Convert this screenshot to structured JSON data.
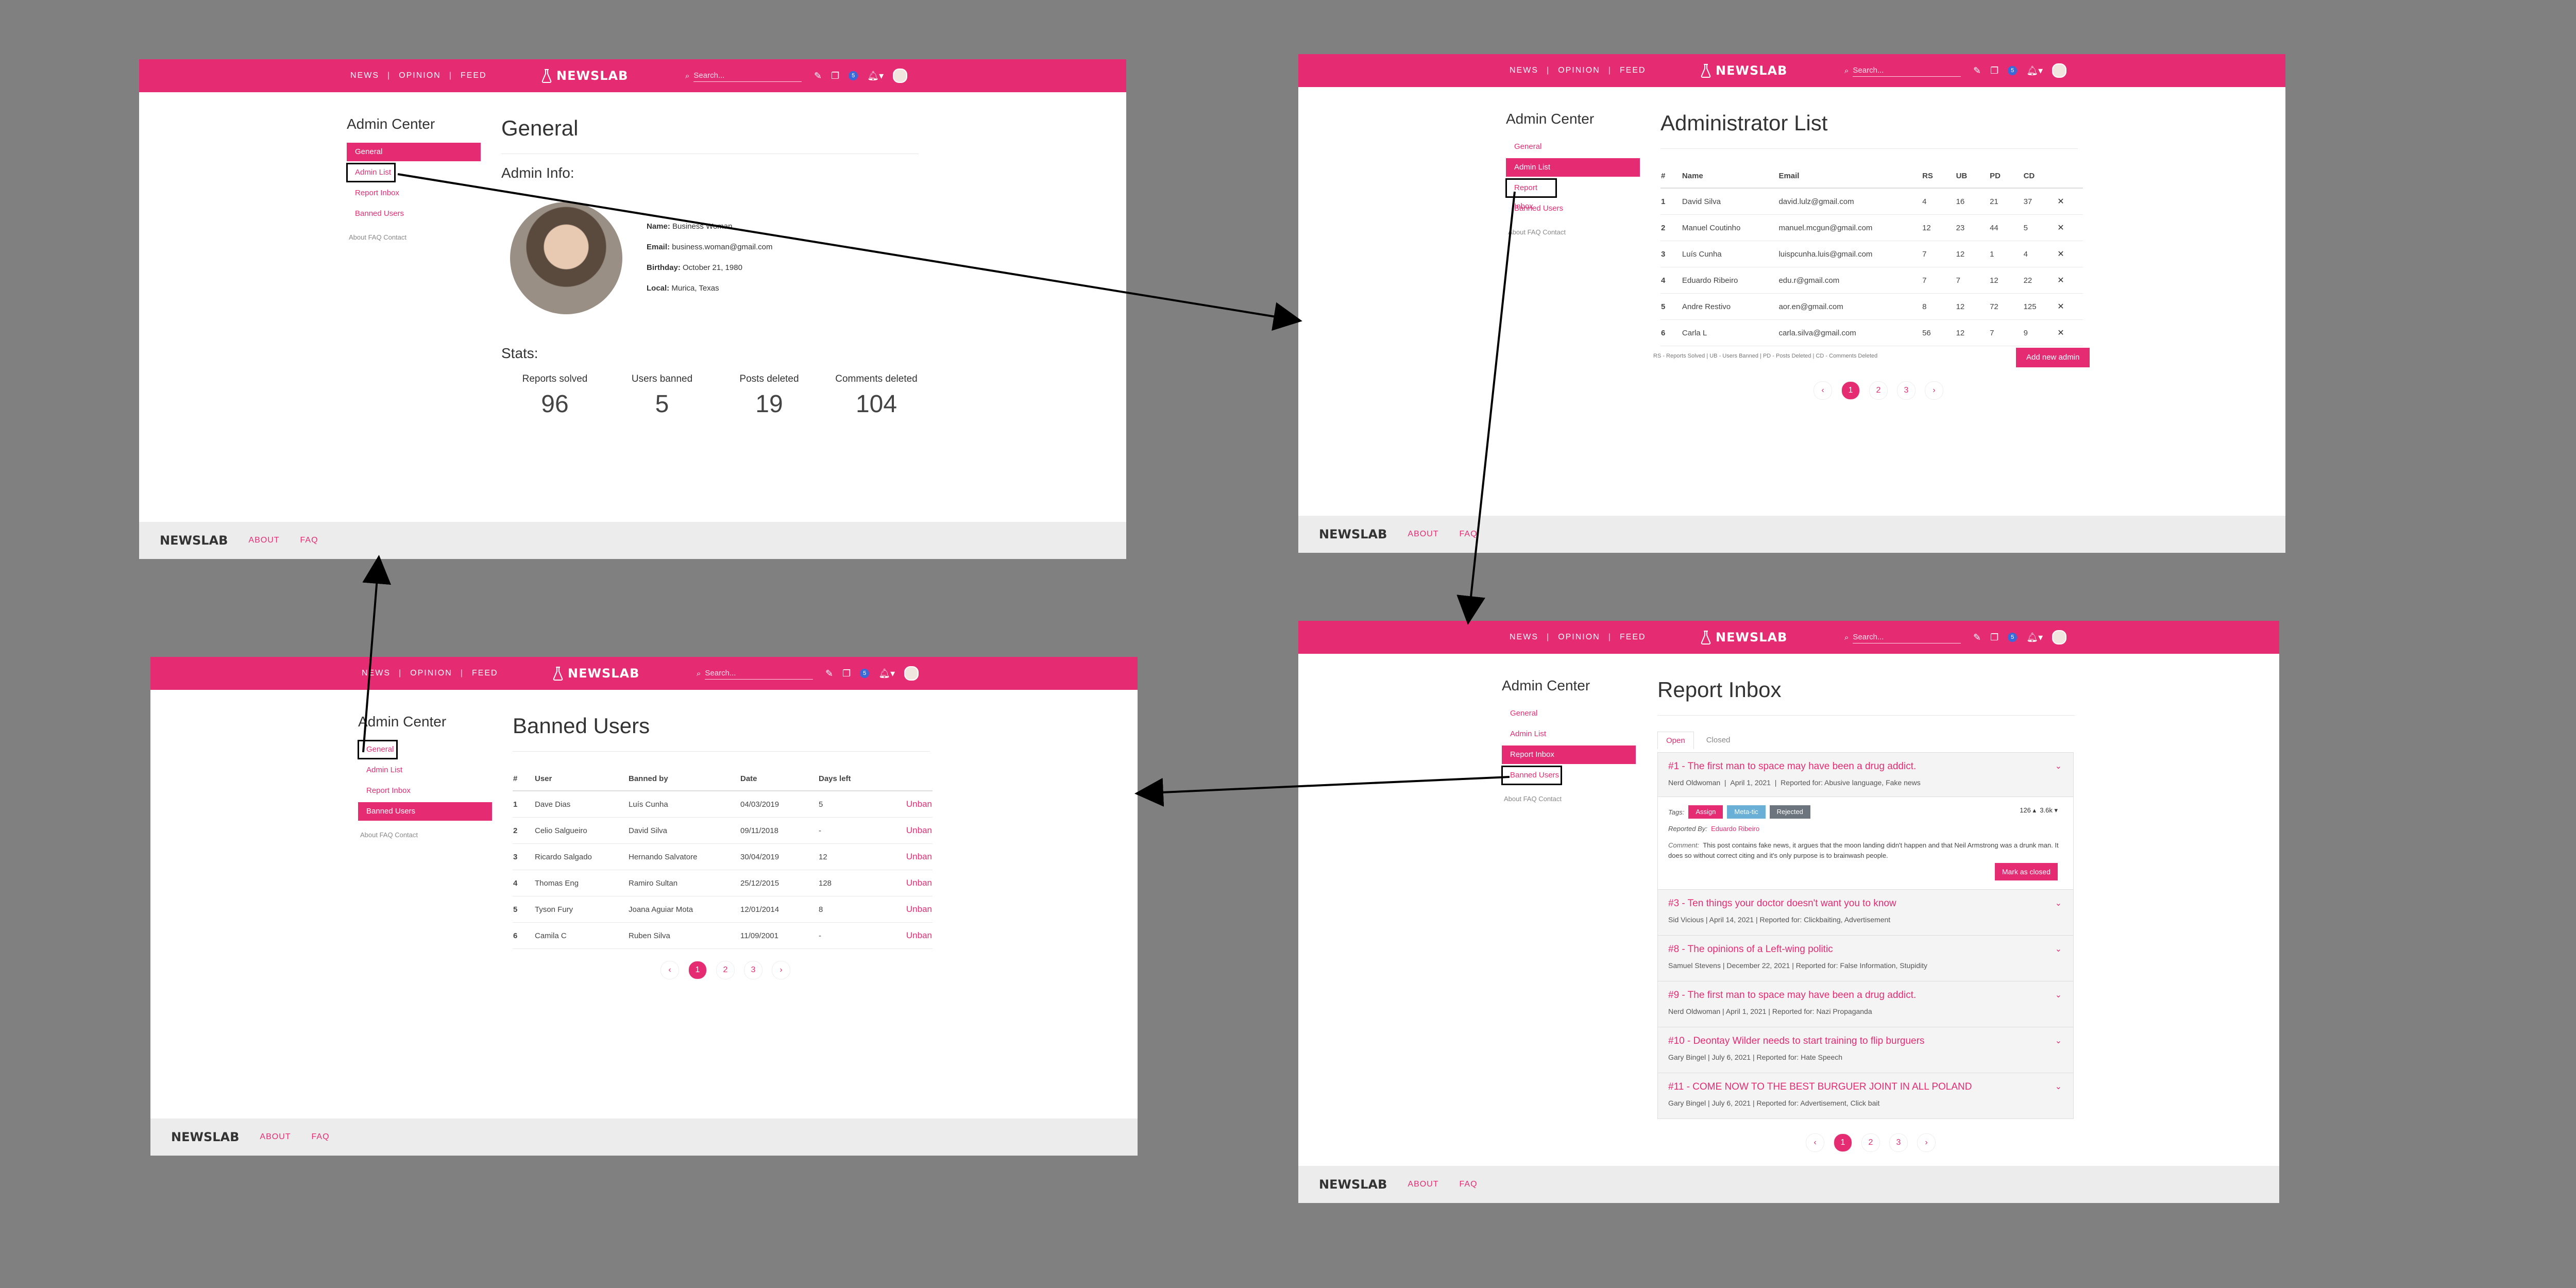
{
  "header": {
    "nav": [
      "NEWS",
      "OPINION",
      "FEED"
    ],
    "separator": "|",
    "brand": "NEWSLAB",
    "search_placeholder": "Search...",
    "notif_count": "5"
  },
  "footer": {
    "brand": "NEWSLAB",
    "about": "ABOUT",
    "faq": "FAQ"
  },
  "sidebar": {
    "title": "Admin Center",
    "items": [
      "General",
      "Admin List",
      "Report Inbox",
      "Banned Users"
    ],
    "minilinks": "About  FAQ  Contact"
  },
  "general": {
    "title": "General",
    "info_heading": "Admin Info:",
    "name_label": "Name:",
    "name": "Business Woman",
    "email_label": "Email:",
    "email": "business.woman@gmail.com",
    "birthday_label": "Birthday:",
    "birthday": "October 21, 1980",
    "local_label": "Local:",
    "local": "Murica, Texas",
    "stats_heading": "Stats:",
    "stats": [
      {
        "label": "Reports solved",
        "value": "96"
      },
      {
        "label": "Users banned",
        "value": "5"
      },
      {
        "label": "Posts deleted",
        "value": "19"
      },
      {
        "label": "Comments deleted",
        "value": "104"
      }
    ]
  },
  "admins": {
    "title": "Administrator List",
    "columns": [
      "#",
      "Name",
      "Email",
      "RS",
      "UB",
      "PD",
      "CD"
    ],
    "rows": [
      [
        "1",
        "David Silva",
        "david.lulz@gmail.com",
        "4",
        "16",
        "21",
        "37"
      ],
      [
        "2",
        "Manuel Coutinho",
        "manuel.mcgun@gmail.com",
        "12",
        "23",
        "44",
        "5"
      ],
      [
        "3",
        "Luís Cunha",
        "luispcunha.luis@gmail.com",
        "7",
        "12",
        "1",
        "4"
      ],
      [
        "4",
        "Eduardo Ribeiro",
        "edu.r@gmail.com",
        "7",
        "7",
        "12",
        "22"
      ],
      [
        "5",
        "Andre Restivo",
        "aor.en@gmail.com",
        "8",
        "12",
        "72",
        "125"
      ],
      [
        "6",
        "Carla L",
        "carla.silva@gmail.com",
        "56",
        "12",
        "7",
        "9"
      ]
    ],
    "remove_symbol": "✕",
    "legend": "RS - Reports Solved | UB - Users Banned | PD - Posts Deleted | CD - Comments Deleted",
    "add_button": "Add new admin",
    "pages": [
      "‹",
      "1",
      "2",
      "3",
      "›"
    ]
  },
  "reports": {
    "title": "Report Inbox",
    "tabs": [
      "Open",
      "Closed"
    ],
    "expanded": {
      "title": "#1 - The first man to space may have been a drug addict.",
      "author": "Nerd Oldwoman",
      "date": "April 1, 2021",
      "reported_for": "Reported for: Abusive language, Fake news",
      "tags_label": "Tags:",
      "tags": [
        "Assign",
        "Meta-tic",
        "Rejected"
      ],
      "votes_up": "126 ▴",
      "votes_down": "3.6k ▾",
      "reported_by_label": "Reported By:",
      "reported_by": "Eduardo Ribeiro",
      "comment_label": "Comment:",
      "comment": "This post contains fake news, it argues that the moon landing didn't happen and that Neil Armstrong was a drunk man. It does so without correct citing and it's only purpose is to brainwash people.",
      "close_button": "Mark as closed"
    },
    "items": [
      {
        "title": "#3 - Ten things your doctor doesn't want you to know",
        "author": "Sid Vicious",
        "date": "April 14, 2021",
        "reported_for": "Reported for: Clickbaiting, Advertisement"
      },
      {
        "title": "#8 - The opinions of a Left-wing politic",
        "author": "Samuel Stevens",
        "date": "December 22, 2021",
        "reported_for": "Reported for: False Information, Stupidity"
      },
      {
        "title": "#9 - The first man to space may have been a drug addict.",
        "author": "Nerd Oldwoman",
        "date": "April 1, 2021",
        "reported_for": "Reported for: Nazi Propaganda"
      },
      {
        "title": "#10 - Deontay Wilder needs to start training to flip burguers",
        "author": "Gary Bingel",
        "date": "July 6, 2021",
        "reported_for": "Reported for: Hate Speech"
      },
      {
        "title": "#11 - COME NOW TO THE BEST BURGUER JOINT IN ALL POLAND",
        "author": "Gary Bingel",
        "date": "July 6, 2021",
        "reported_for": "Reported for: Advertisement, Click bait"
      }
    ],
    "pages": [
      "‹",
      "1",
      "2",
      "3",
      "›"
    ]
  },
  "banned": {
    "title": "Banned Users",
    "columns": [
      "#",
      "User",
      "Banned by",
      "Date",
      "Days left"
    ],
    "rows": [
      [
        "1",
        "Dave Dias",
        "Luís Cunha",
        "04/03/2019",
        "5",
        "Unban"
      ],
      [
        "2",
        "Celio Salgueiro",
        "David Silva",
        "09/11/2018",
        "-",
        "Unban"
      ],
      [
        "3",
        "Ricardo Salgado",
        "Hernando Salvatore",
        "30/04/2019",
        "12",
        "Unban"
      ],
      [
        "4",
        "Thomas Eng",
        "Ramiro Sultan",
        "25/12/2015",
        "128",
        "Unban"
      ],
      [
        "5",
        "Tyson Fury",
        "Joana Aguiar Mota",
        "12/01/2014",
        "8",
        "Unban"
      ],
      [
        "6",
        "Camila C",
        "Ruben Silva",
        "11/09/2001",
        "-",
        "Unban"
      ]
    ],
    "pages": [
      "‹",
      "1",
      "2",
      "3",
      "›"
    ]
  },
  "colors": {
    "accent": "#e52c73",
    "background": "#808080",
    "footer": "#ececec"
  }
}
